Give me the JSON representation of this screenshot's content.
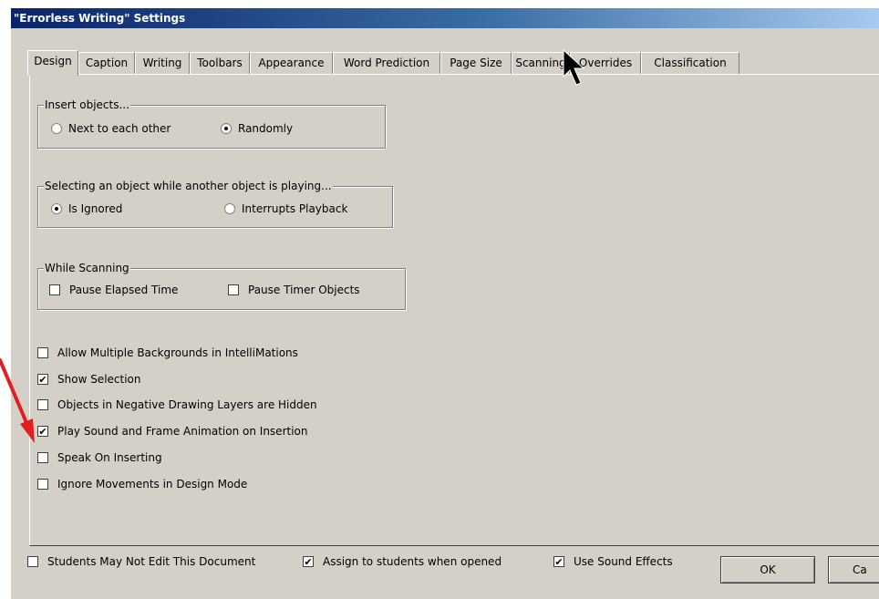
{
  "window": {
    "title": "\"Errorless Writing\" Settings"
  },
  "tabs": [
    "Design",
    "Caption",
    "Writing",
    "Toolbars",
    "Appearance",
    "Word Prediction",
    "Page Size",
    "Scanning",
    "Overrides",
    "Classification"
  ],
  "groups": {
    "insert": {
      "label": "Insert objects...",
      "options": [
        {
          "label": "Next to each other",
          "selected": false
        },
        {
          "label": "Randomly",
          "selected": true
        }
      ]
    },
    "selecting": {
      "label": "Selecting an object while another object is playing...",
      "options": [
        {
          "label": "Is Ignored",
          "selected": true
        },
        {
          "label": "Interrupts Playback",
          "selected": false
        }
      ]
    },
    "scanning": {
      "label": "While Scanning",
      "options": [
        {
          "label": "Pause Elapsed Time",
          "checked": false
        },
        {
          "label": "Pause Timer Objects",
          "checked": false
        }
      ]
    }
  },
  "checks": [
    {
      "label": "Allow Multiple Backgrounds in IntelliMations",
      "checked": false
    },
    {
      "label": "Show Selection",
      "checked": true
    },
    {
      "label": "Objects in Negative Drawing Layers are Hidden",
      "checked": false
    },
    {
      "label": "Play Sound and Frame Animation on Insertion",
      "checked": true
    },
    {
      "label": "Speak On Inserting",
      "checked": false
    },
    {
      "label": "Ignore Movements in Design Mode",
      "checked": false
    }
  ],
  "bottom": [
    {
      "label": "Students May Not Edit This Document",
      "checked": false
    },
    {
      "label": "Assign to students when opened",
      "checked": true
    },
    {
      "label": "Use Sound Effects",
      "checked": true
    }
  ],
  "buttons": {
    "ok": "OK",
    "cancel": "Ca"
  },
  "colors": {
    "annotation_arrow": "#e02020",
    "dialog_face": "#d4d0c8"
  },
  "icons": {
    "checkmark": "✔"
  }
}
